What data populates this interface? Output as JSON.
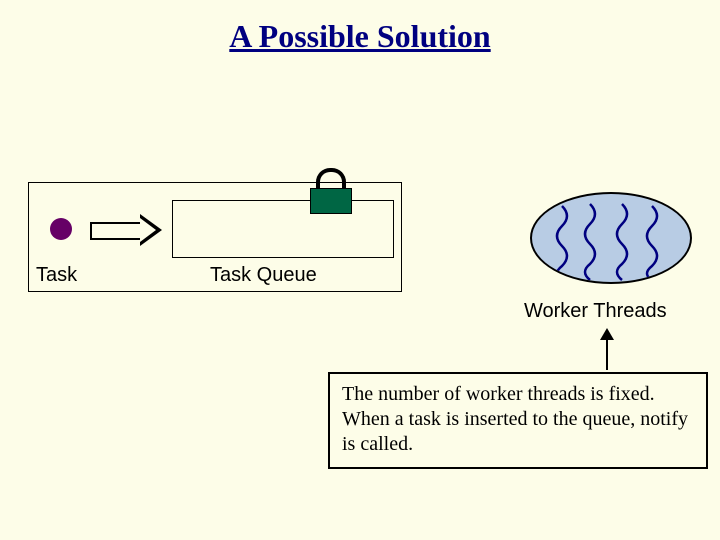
{
  "title": "A Possible Solution",
  "task_label": "Task",
  "queue_label": "Task Queue",
  "threads_label": "Worker Threads",
  "note_text": "The number of worker threads is fixed. When a task is inserted to the queue, notify is called.",
  "icons": {
    "lock": "lock-icon",
    "arrow_right": "arrow-right-icon",
    "arrow_up": "arrow-up-icon",
    "task_dot": "task-dot-icon",
    "thread_squiggle": "thread-squiggle-icon"
  },
  "colors": {
    "background": "#fdfde8",
    "title": "#000080",
    "task_dot": "#660066",
    "lock_body": "#006644",
    "threads_fill": "#b8cce4",
    "thread_stroke": "#000080"
  },
  "thread_count": 4
}
